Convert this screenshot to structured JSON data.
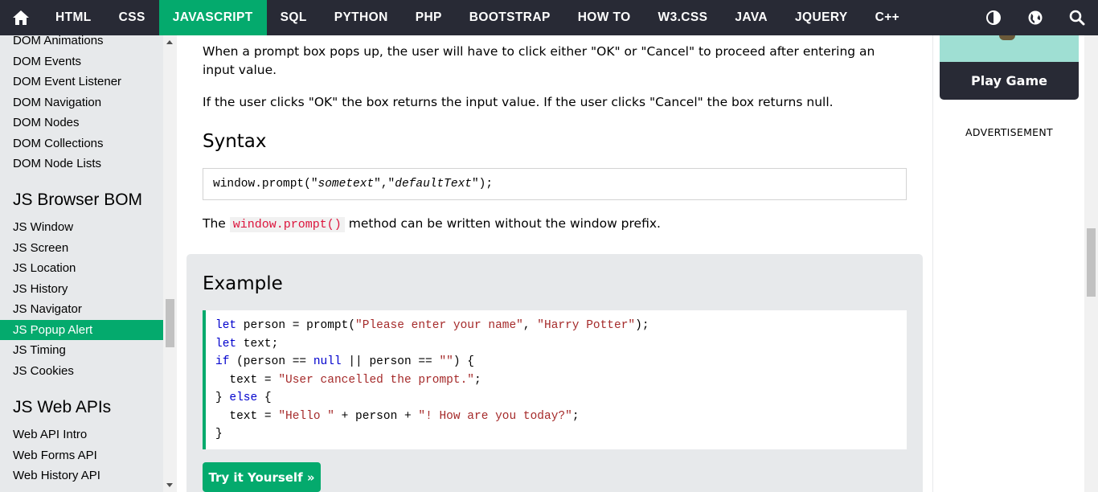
{
  "nav": {
    "links": [
      "HTML",
      "CSS",
      "JAVASCRIPT",
      "SQL",
      "PYTHON",
      "PHP",
      "BOOTSTRAP",
      "HOW TO",
      "W3.CSS",
      "JAVA",
      "JQUERY",
      "C++"
    ],
    "active": "JAVASCRIPT",
    "accent": "#04AA6D",
    "background": "#282A35",
    "right_icons": [
      "contrast-icon",
      "globe-icon",
      "search-icon"
    ]
  },
  "sidebar": {
    "group1": [
      "DOM Animations",
      "DOM Events",
      "DOM Event Listener",
      "DOM Navigation",
      "DOM Nodes",
      "DOM Collections",
      "DOM Node Lists"
    ],
    "heading2": "JS Browser BOM",
    "group2": [
      "JS Window",
      "JS Screen",
      "JS Location",
      "JS History",
      "JS Navigator",
      "JS Popup Alert",
      "JS Timing",
      "JS Cookies"
    ],
    "active": "JS Popup Alert",
    "heading3": "JS Web APIs",
    "group3": [
      "Web API Intro",
      "Web Forms API",
      "Web History API"
    ]
  },
  "main": {
    "para1": "When a prompt box pops up, the user will have to click either \"OK\" or \"Cancel\" to proceed after entering an input value.",
    "para2": "If the user clicks \"OK\" the box returns the input value. If the user clicks \"Cancel\" the box returns null.",
    "syntax_heading": "Syntax",
    "syntax_prefix": "window.prompt(\"",
    "syntax_arg1": "sometext",
    "syntax_mid": "\",\"",
    "syntax_arg2": "defaultText",
    "syntax_suffix": "\");",
    "note_pre": "The",
    "note_code": "window.prompt()",
    "note_post": "method can be written without the window prefix.",
    "example_heading": "Example",
    "code": [
      [
        [
          "kw",
          "let"
        ],
        [
          "",
          " person = prompt("
        ],
        [
          "str",
          "\"Please enter your name\""
        ],
        [
          "",
          ", "
        ],
        [
          "str",
          "\"Harry Potter\""
        ],
        [
          "",
          ");"
        ]
      ],
      [
        [
          "kw",
          "let"
        ],
        [
          "",
          " text;"
        ]
      ],
      [
        [
          "kw",
          "if"
        ],
        [
          "",
          " (person == "
        ],
        [
          "kw",
          "null"
        ],
        [
          "",
          " || person == "
        ],
        [
          "str",
          "\"\""
        ],
        [
          "",
          ") {"
        ]
      ],
      [
        [
          "",
          "  text = "
        ],
        [
          "str",
          "\"User cancelled the prompt.\""
        ],
        [
          "",
          ";"
        ]
      ],
      [
        [
          "",
          "} "
        ],
        [
          "kw",
          "else"
        ],
        [
          "",
          " {"
        ]
      ],
      [
        [
          "",
          "  text = "
        ],
        [
          "str",
          "\"Hello \""
        ],
        [
          "",
          " + person + "
        ],
        [
          "str",
          "\"! How are you today?\""
        ],
        [
          "",
          ";"
        ]
      ],
      [
        [
          "",
          "}"
        ]
      ]
    ],
    "try_button": "Try it Yourself »"
  },
  "right": {
    "game_button": "Play Game",
    "ad_label": "ADVERTISEMENT"
  }
}
